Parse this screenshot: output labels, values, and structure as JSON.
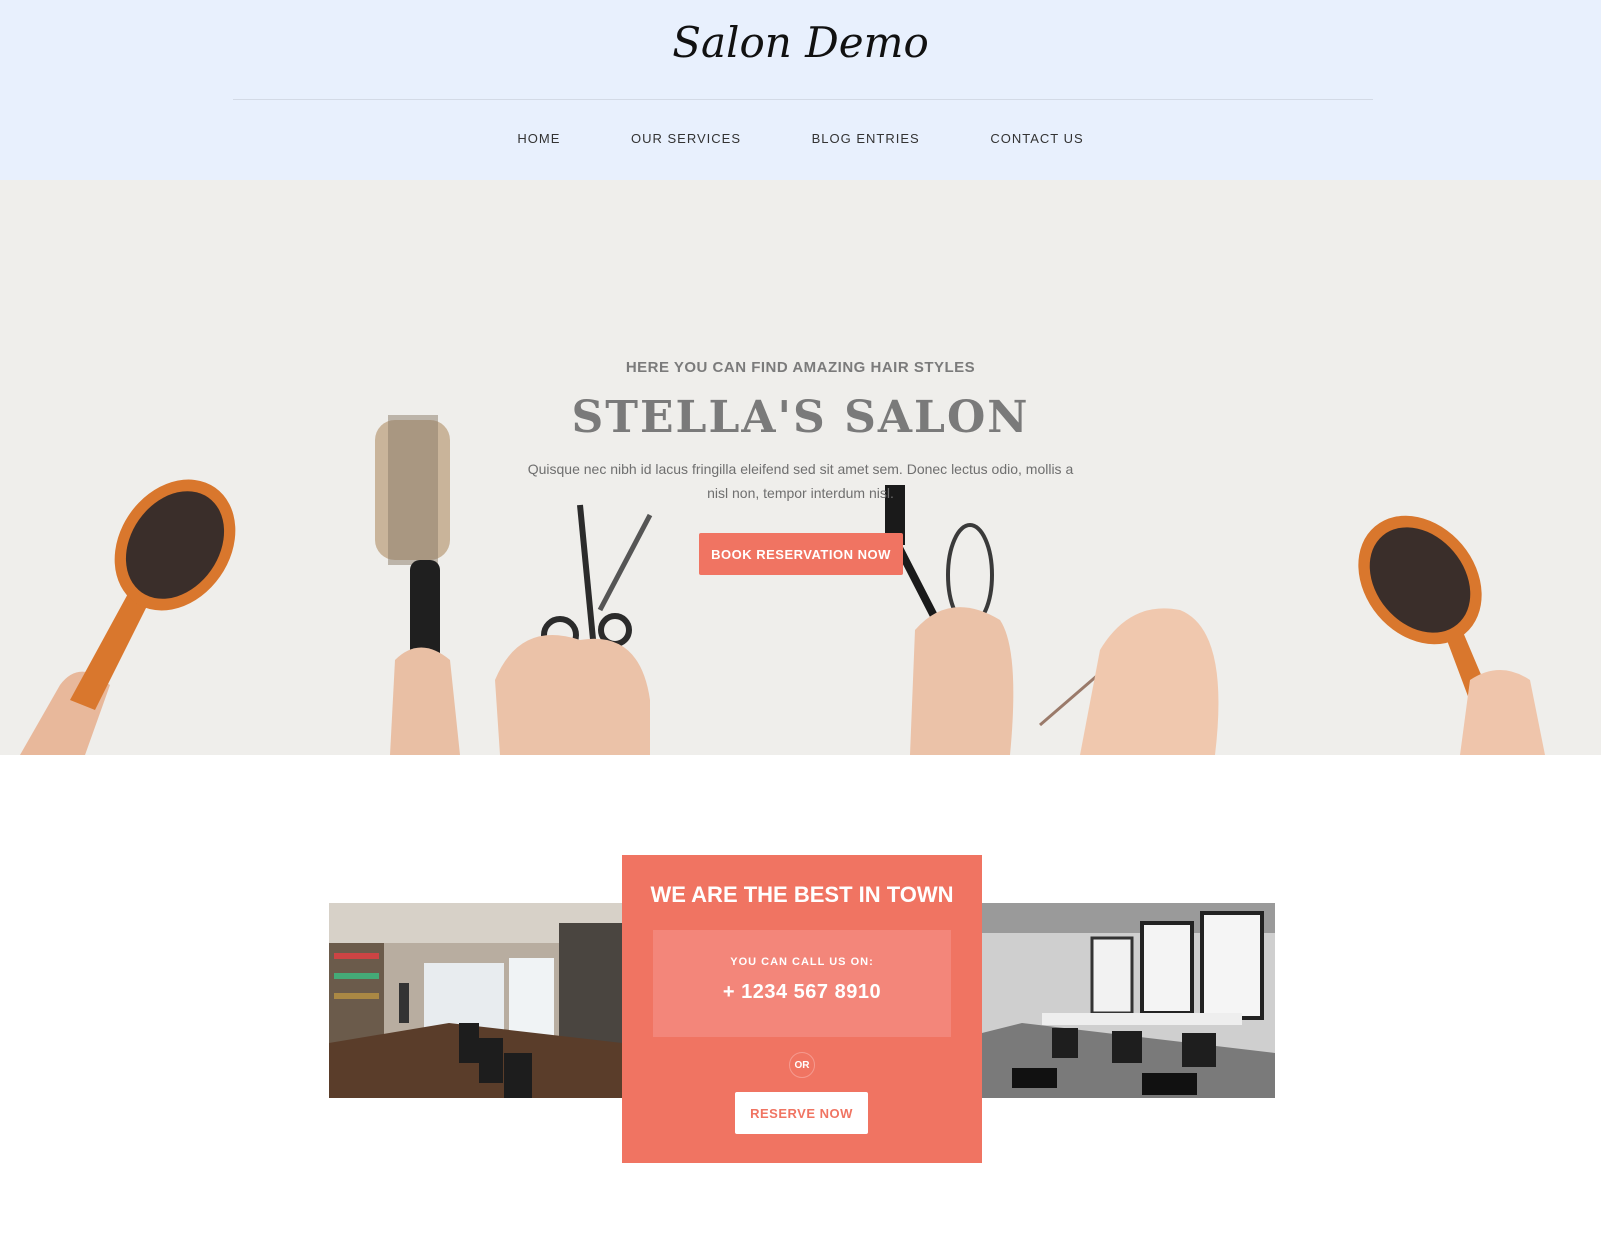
{
  "site": {
    "logo": "Salon Demo"
  },
  "nav": {
    "items": [
      "HOME",
      "OUR SERVICES",
      "BLOG ENTRIES",
      "CONTACT US"
    ]
  },
  "hero": {
    "kicker": "HERE YOU CAN FIND AMAZING HAIR STYLES",
    "title": "STELLA'S SALON",
    "text": "Quisque nec nibh id lacus fringilla eleifend sed sit amet sem. Donec lectus odio, mollis a nisl non, tempor interdum nisl.",
    "button": "BOOK RESERVATION NOW"
  },
  "cta": {
    "title": "WE ARE THE BEST IN TOWN",
    "call_label": "YOU CAN CALL US ON:",
    "phone": "+ 1234 567 8910",
    "or": "OR",
    "button": "RESERVE NOW"
  },
  "colors": {
    "accent": "#f07462",
    "header_bg": "#e8f0fd",
    "call_box": "#f3867a"
  }
}
